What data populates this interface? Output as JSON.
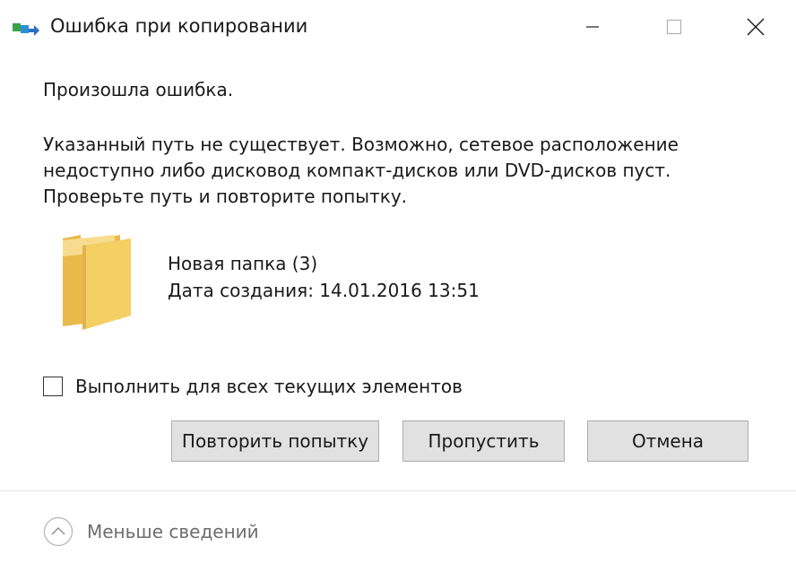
{
  "window": {
    "title": "Ошибка при копировании"
  },
  "controls": {
    "minimize_icon": "minimize-icon",
    "maximize_icon": "maximize-icon",
    "close_icon": "close-icon"
  },
  "content": {
    "heading": "Произошла ошибка.",
    "message_lines": [
      "Указанный путь не существует. Возможно, сетевое расположение",
      "недоступно либо дисковод компакт-дисков или DVD-дисков пуст.",
      "Проверьте путь и повторите попытку."
    ],
    "item": {
      "icon": "folder-icon",
      "name": "Новая папка (3)",
      "date": "Дата создания: 14.01.2016 13:51"
    },
    "apply_all": {
      "label": "Выполнить для всех текущих элементов",
      "checked": false
    }
  },
  "buttons": {
    "retry": "Повторить попытку",
    "skip": "Пропустить",
    "cancel": "Отмена"
  },
  "footer": {
    "toggle_icon": "chevron-up-icon",
    "label": "Меньше сведений"
  },
  "colors": {
    "folder": "#f4cf63",
    "button_bg": "#e1e1e1",
    "button_border": "#adadad",
    "footer_text": "#6d6d6d"
  }
}
